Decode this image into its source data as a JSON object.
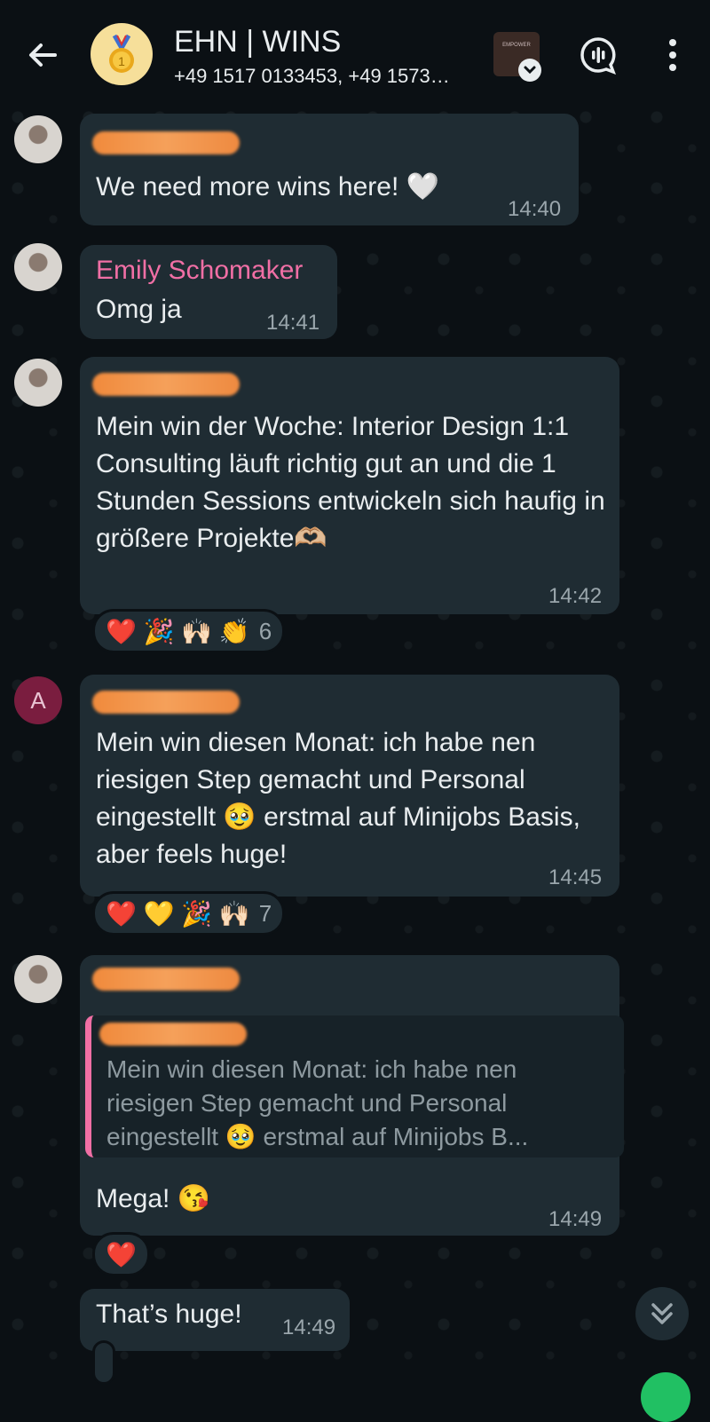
{
  "header": {
    "back_icon": "arrow-left-icon",
    "title": "EHN | WINS",
    "subtitle": "+49 1517 0133453, +49 1573…",
    "group_avatar_icon": "medal-icon",
    "call_icon": "voice-chat-icon",
    "menu_icon": "more-vertical-icon",
    "thumbnail_text": "EMPOWER"
  },
  "messages": [
    {
      "text": "We need more wins here! 🤍",
      "time": "14:40"
    },
    {
      "sender": "Emily Schomaker",
      "text": "Omg ja",
      "time": "14:41"
    },
    {
      "text": "Mein win der Woche: Interior Design 1:1 Consulting läuft richtig gut an und die 1 Stunden Sessions entwickeln sich haufig in größere Projekte🫶🏼",
      "time": "14:42",
      "reactions": {
        "emojis": "❤️ 🎉 🙌🏻 👏",
        "count": "6"
      }
    },
    {
      "avatar_letter": "A",
      "text": "Mein win diesen Monat: ich habe nen riesigen Step gemacht und Personal eingestellt 🥹 erstmal auf Minijobs Basis, aber feels huge!",
      "time": "14:45",
      "reactions": {
        "emojis": "❤️ 💛 🎉 🙌🏻",
        "count": "7"
      }
    },
    {
      "quote": "Mein win diesen Monat: ich habe nen riesigen Step gemacht und Personal eingestellt 🥹 erstmal auf Minijobs B...",
      "text": "Mega! 😘",
      "time": "14:49",
      "reactions": {
        "emojis": "❤️"
      }
    },
    {
      "text": "That’s huge!",
      "time": "14:49"
    }
  ],
  "colors": {
    "bubble": "#1f2c33",
    "background": "#0b1014",
    "sender_pink": "#f06fa5",
    "accent_green": "#21c063"
  }
}
